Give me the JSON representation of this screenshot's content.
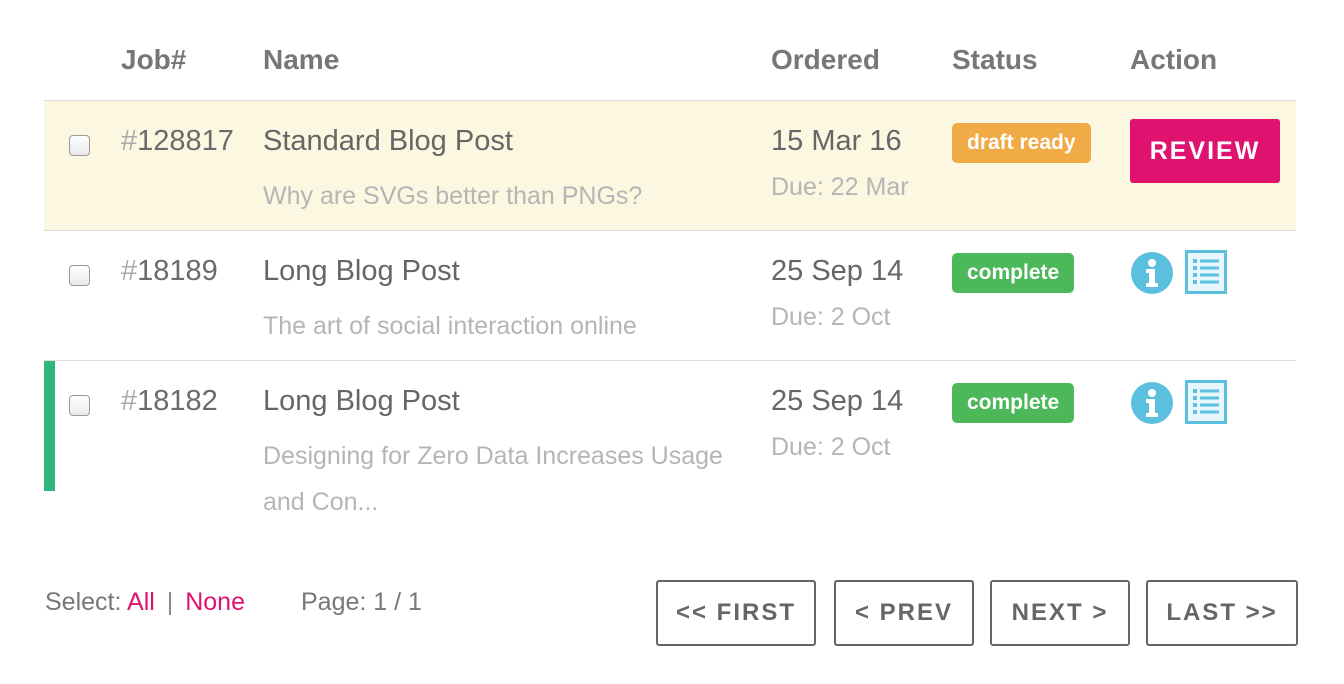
{
  "columns": {
    "job": "Job#",
    "name": "Name",
    "ordered": "Ordered",
    "status": "Status",
    "action": "Action"
  },
  "jobs": [
    {
      "hash": "#",
      "number": "128817",
      "name": "Standard Blog Post",
      "subtitle": "Why are SVGs better than PNGs?",
      "ordered": "15 Mar 16",
      "due": "Due: 22 Mar",
      "status": "draft ready",
      "action_label": "REVIEW",
      "checked": false,
      "highlighted": true
    },
    {
      "hash": "#",
      "number": "18189",
      "name": "Long Blog Post",
      "subtitle": "The art of social interaction online",
      "ordered": "25 Sep 14",
      "due": "Due: 2 Oct",
      "status": "complete",
      "actions": [
        "info-icon",
        "list-icon"
      ],
      "checked": false
    },
    {
      "hash": "#",
      "number": "18182",
      "name": "Long Blog Post",
      "subtitle": "Designing for Zero Data Increases Usage and Con...",
      "ordered": "25 Sep 14",
      "due": "Due: 2 Oct",
      "status": "complete",
      "actions": [
        "info-icon",
        "list-icon"
      ],
      "checked": false,
      "accent": true
    }
  ],
  "footer": {
    "select_label": "Select:",
    "all": "All",
    "separator": "|",
    "none": "None",
    "page": "Page: 1 / 1"
  },
  "pagination": {
    "first": "<< FIRST",
    "prev": "< PREV",
    "next": "NEXT >",
    "last": "LAST >>"
  },
  "colors": {
    "accent_pink": "#e0126f",
    "draft_ready": "#f0ab46",
    "complete": "#4cb85a",
    "highlight_row": "#fcf7e1",
    "row_marker": "#2fb67c",
    "icon_blue": "#5bc0de"
  }
}
